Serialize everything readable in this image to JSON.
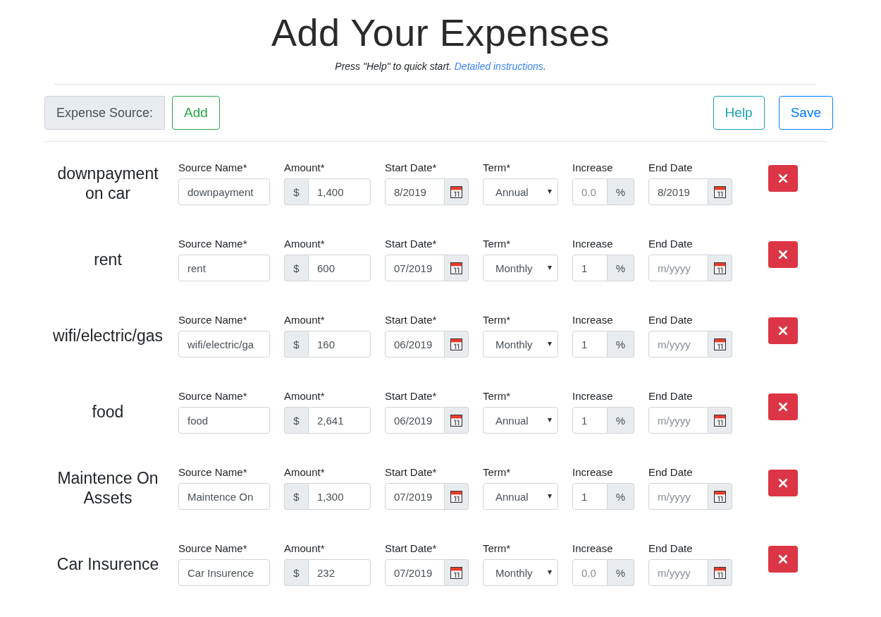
{
  "header": {
    "title": "Add Your Expenses",
    "subtitle": "Press \"Help\" to quick start. ",
    "subtitle_link": "Detailed instructions",
    "subtitle_end": "."
  },
  "toolbar": {
    "label": "Expense Source:",
    "add_button": "Add",
    "help_button": "Help",
    "save_button": "Save"
  },
  "expenses": [
    {
      "title": "downpayment on car",
      "fields": [
        {
          "kind": "text",
          "label": "Source Name*",
          "value": "downpayment"
        },
        {
          "kind": "prefixed",
          "label": "Amount*",
          "addon": "$",
          "value": "1,400"
        },
        {
          "kind": "date",
          "label": "Start Date*",
          "value": "8/2019"
        },
        {
          "kind": "select",
          "label": "Term*",
          "value": "Annual"
        },
        {
          "kind": "suffixed",
          "label": "Increase",
          "addon": "%",
          "placeholder": "0.0"
        },
        {
          "kind": "date",
          "label": "End Date",
          "value": "8/2019"
        }
      ]
    },
    {
      "title": "rent",
      "fields": [
        {
          "kind": "text",
          "label": "Source Name*",
          "value": "rent"
        },
        {
          "kind": "prefixed",
          "label": "Amount*",
          "addon": "$",
          "value": "600"
        },
        {
          "kind": "date",
          "label": "Start Date*",
          "value": "07/2019"
        },
        {
          "kind": "select",
          "label": "Term*",
          "value": "Monthly"
        },
        {
          "kind": "suffixed",
          "label": "Increase",
          "addon": "%",
          "value": "1"
        },
        {
          "kind": "date",
          "label": "End Date",
          "placeholder": "m/yyyy"
        }
      ]
    },
    {
      "title": "wifi/electric/gas",
      "fields": [
        {
          "kind": "text",
          "label": "Source Name*",
          "value": "wifi/electric/ga"
        },
        {
          "kind": "prefixed",
          "label": "Amount*",
          "addon": "$",
          "value": "160"
        },
        {
          "kind": "date",
          "label": "Start Date*",
          "value": "06/2019"
        },
        {
          "kind": "select",
          "label": "Term*",
          "value": "Monthly"
        },
        {
          "kind": "suffixed",
          "label": "Increase",
          "addon": "%",
          "value": "1"
        },
        {
          "kind": "date",
          "label": "End Date",
          "placeholder": "m/yyyy"
        }
      ]
    },
    {
      "title": "food",
      "fields": [
        {
          "kind": "text",
          "label": "Source Name*",
          "value": "food"
        },
        {
          "kind": "prefixed",
          "label": "Amount*",
          "addon": "$",
          "value": "2,641"
        },
        {
          "kind": "date",
          "label": "Start Date*",
          "value": "06/2019"
        },
        {
          "kind": "select",
          "label": "Term*",
          "value": "Annual"
        },
        {
          "kind": "suffixed",
          "label": "Increase",
          "addon": "%",
          "value": "1"
        },
        {
          "kind": "date",
          "label": "End Date",
          "placeholder": "m/yyyy"
        }
      ]
    },
    {
      "title": "Maintence On Assets",
      "fields": [
        {
          "kind": "text",
          "label": "Source Name*",
          "value": "Maintence On"
        },
        {
          "kind": "prefixed",
          "label": "Amount*",
          "addon": "$",
          "value": "1,300"
        },
        {
          "kind": "date",
          "label": "Start Date*",
          "value": "07/2019"
        },
        {
          "kind": "select",
          "label": "Term*",
          "value": "Annual"
        },
        {
          "kind": "suffixed",
          "label": "Increase",
          "addon": "%",
          "value": "1"
        },
        {
          "kind": "date",
          "label": "End Date",
          "placeholder": "m/yyyy"
        }
      ]
    },
    {
      "title": "Car Insurence",
      "fields": [
        {
          "kind": "text",
          "label": "Source Name*",
          "value": "Car Insurence"
        },
        {
          "kind": "prefixed",
          "label": "Amount*",
          "addon": "$",
          "value": "232"
        },
        {
          "kind": "date",
          "label": "Start Date*",
          "value": "07/2019"
        },
        {
          "kind": "select",
          "label": "Term*",
          "value": "Monthly"
        },
        {
          "kind": "suffixed",
          "label": "Increase",
          "addon": "%",
          "placeholder": "0.0"
        },
        {
          "kind": "date",
          "label": "End Date",
          "placeholder": "m/yyyy"
        }
      ]
    }
  ]
}
